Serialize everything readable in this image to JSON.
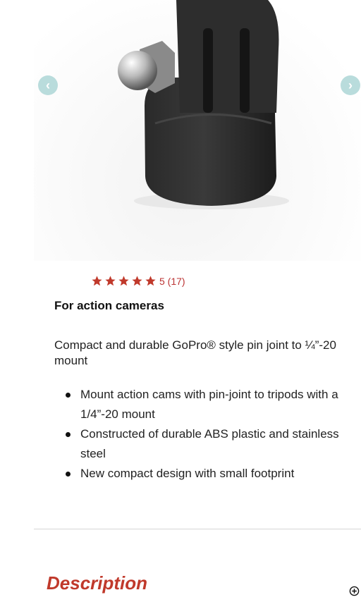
{
  "carousel": {
    "prev_icon": "chevron-left-icon",
    "next_icon": "chevron-right-icon",
    "accent": "#b9dcdc"
  },
  "rating": {
    "stars": 5,
    "text": "5 (17)",
    "color": "#c0392b"
  },
  "product": {
    "subtitle": "For action cameras",
    "description": "Compact and durable GoPro® style pin joint to ¼”-20 mount",
    "features": [
      "Mount action cams with pin-joint to tripods with a 1/4”-20 mount",
      "Constructed of durable ABS plastic and stainless steel",
      "New compact design with small footprint"
    ]
  },
  "section": {
    "title": "Description",
    "expand_icon": "plus-circle-icon"
  }
}
